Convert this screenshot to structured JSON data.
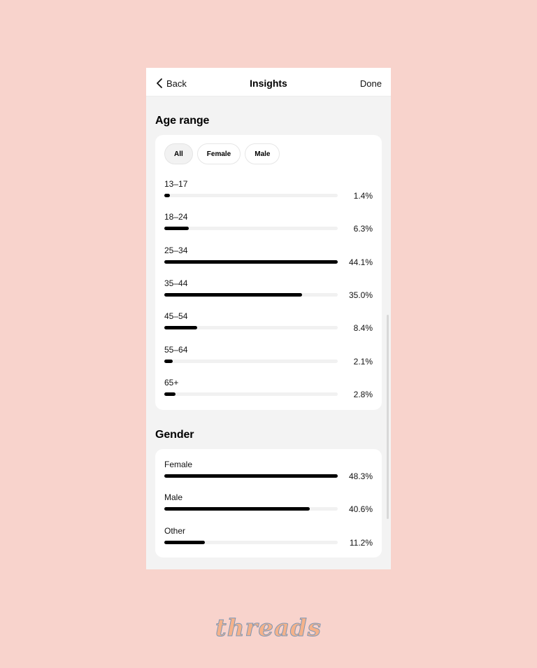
{
  "header": {
    "back_label": "Back",
    "title": "Insights",
    "done_label": "Done"
  },
  "age_section": {
    "title": "Age range",
    "filters": [
      {
        "label": "All",
        "selected": true
      },
      {
        "label": "Female",
        "selected": false
      },
      {
        "label": "Male",
        "selected": false
      }
    ],
    "rows": [
      {
        "label": "13–17",
        "value_text": "1.4%",
        "value": 1.4
      },
      {
        "label": "18–24",
        "value_text": "6.3%",
        "value": 6.3
      },
      {
        "label": "25–34",
        "value_text": "44.1%",
        "value": 44.1
      },
      {
        "label": "35–44",
        "value_text": "35.0%",
        "value": 35.0
      },
      {
        "label": "45–54",
        "value_text": "8.4%",
        "value": 8.4
      },
      {
        "label": "55–64",
        "value_text": "2.1%",
        "value": 2.1
      },
      {
        "label": "65+",
        "value_text": "2.8%",
        "value": 2.8
      }
    ]
  },
  "gender_section": {
    "title": "Gender",
    "rows": [
      {
        "label": "Female",
        "value_text": "48.3%",
        "value": 48.3
      },
      {
        "label": "Male",
        "value_text": "40.6%",
        "value": 40.6
      },
      {
        "label": "Other",
        "value_text": "11.2%",
        "value": 11.2
      }
    ]
  },
  "branding": {
    "logo_text": "threads"
  },
  "colors": {
    "background": "#f8d3cc",
    "bar": "#000000",
    "track": "#f1f1f1",
    "panel": "#f3f3f3"
  }
}
